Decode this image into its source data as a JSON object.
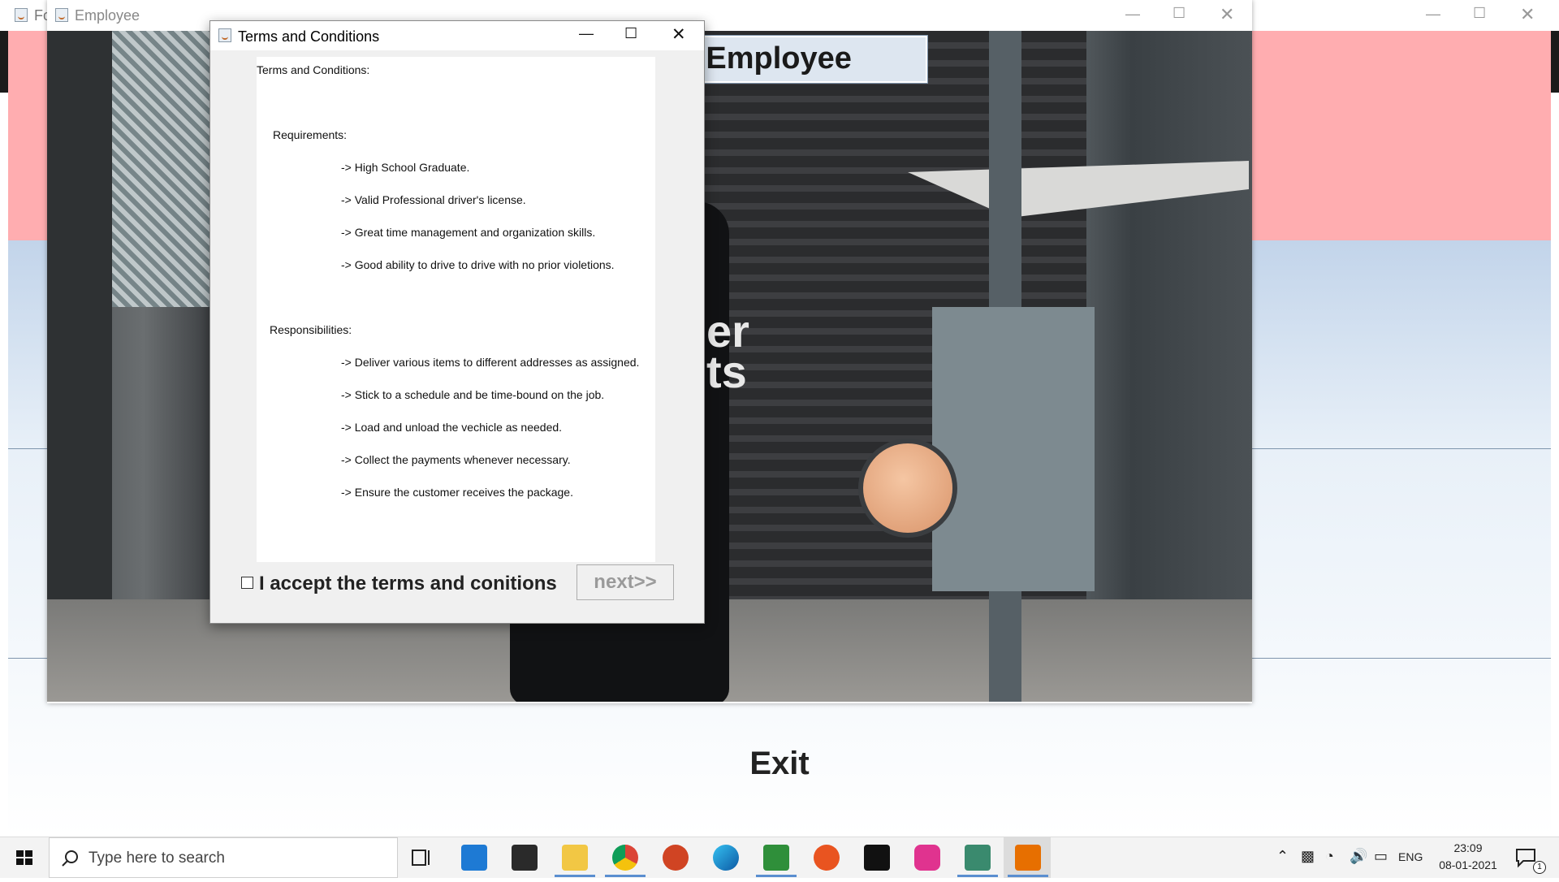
{
  "back_window": {
    "title": "Fo",
    "exit_label": "Exit"
  },
  "employee_window": {
    "title": "Employee",
    "heading": "r Employee",
    "photo_text": "er\nts"
  },
  "dialog": {
    "title": "Terms and Conditions",
    "terms_lines": [
      "Terms and Conditions:",
      "Requirements:",
      "-> High School Graduate.",
      "-> Valid Professional driver's license.",
      "-> Great time management and organization skills.",
      "-> Good ability to drive to drive with no prior violetions.",
      "Responsibilities:",
      "-> Deliver various items to different addresses as assigned.",
      "-> Stick to a schedule and be time-bound on the job.",
      "-> Load and unload the vechicle as needed.",
      "-> Collect the payments whenever necessary.",
      "-> Ensure the customer receives the package."
    ],
    "accept_label": "I accept the terms and conitions",
    "accept_checked": false,
    "next_label": "next>>",
    "next_enabled": false
  },
  "taskbar": {
    "search_placeholder": "Type here to search",
    "apps": [
      "task-view",
      "mail",
      "store",
      "file-explorer",
      "chrome",
      "powerpoint",
      "edge",
      "notepad-plus",
      "ubuntu",
      "terminal",
      "wamp",
      "app",
      "java"
    ],
    "language": "ENG",
    "time": "23:09",
    "date": "08-01-2021",
    "notification_count": "1"
  },
  "colors": {
    "pink_band": "#ffadb0",
    "blue_band": "#c2d4ea",
    "taskbar": "#f3f3f3",
    "accent_underline": "#5a8ed0"
  }
}
